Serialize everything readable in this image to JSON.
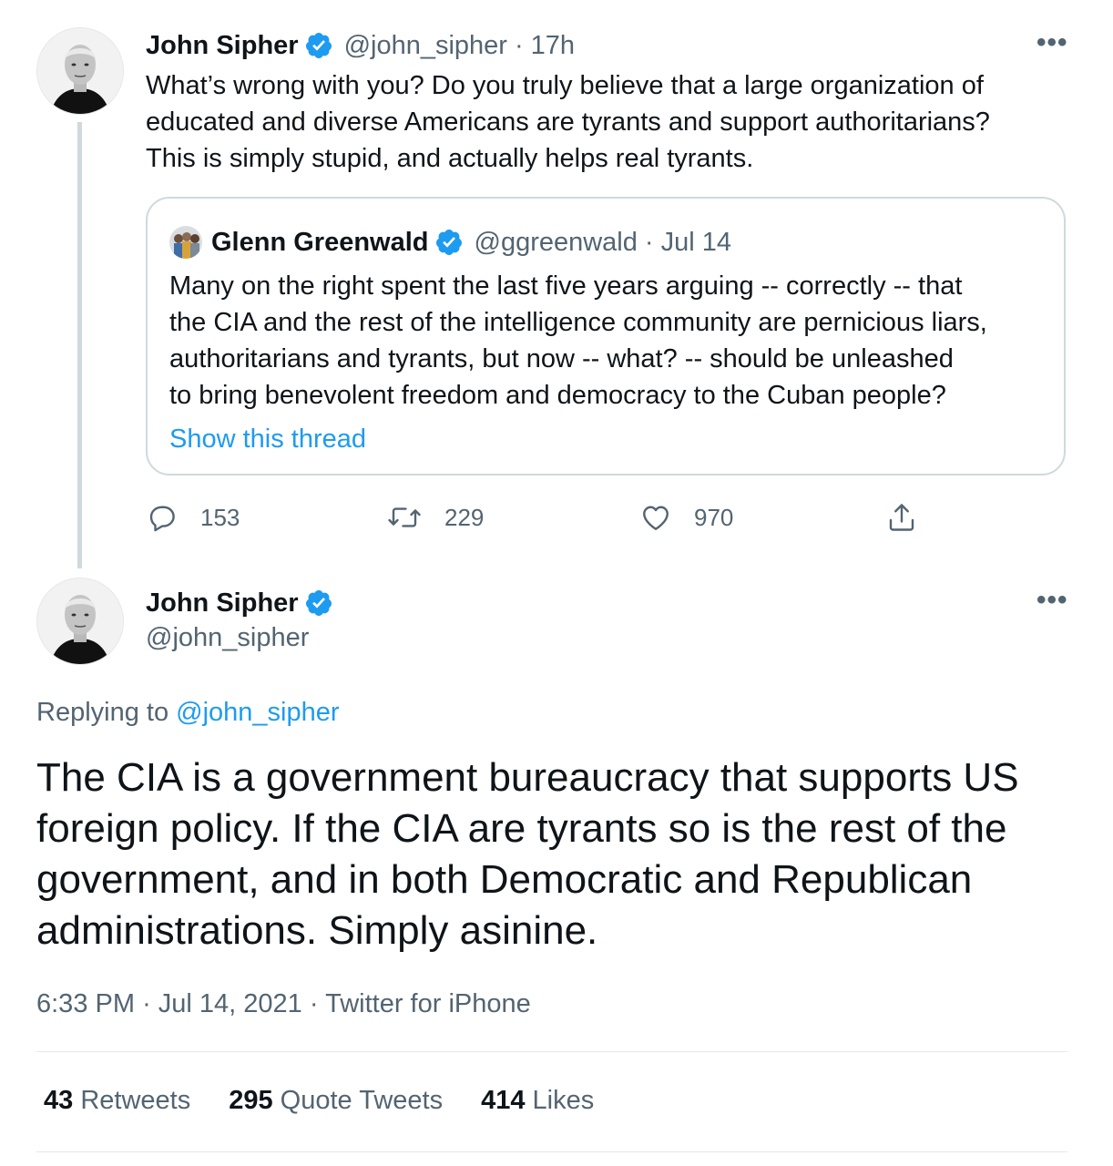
{
  "colors": {
    "accent": "#1d9bf0",
    "secondary_text": "#536471",
    "primary_text": "#0f1419",
    "border": "#cfd9de"
  },
  "parent_tweet": {
    "author_name": "John Sipher",
    "author_handle": "@john_sipher",
    "separator": "·",
    "time": "17h",
    "more_icon": "more-horizontal-icon",
    "text_lines": [
      "What’s wrong with you? Do you truly believe that a large organization of",
      "educated and diverse Americans are tyrants and support authoritarians?",
      "This is simply stupid, and actually helps real tyrants."
    ],
    "quoted": {
      "author_name": "Glenn Greenwald",
      "author_handle": "@ggreenwald",
      "separator": "·",
      "time": "Jul 14",
      "text_lines": [
        "Many on the right spent the last five years arguing -- correctly -- that",
        "the CIA and the rest of the intelligence community are pernicious liars,",
        "authoritarians and tyrants, but now -- what? -- should be unleashed",
        "to bring benevolent freedom and democracy to the Cuban people?"
      ],
      "show_thread": "Show this thread"
    },
    "actions": {
      "replies": "153",
      "retweets": "229",
      "likes": "970"
    }
  },
  "main_tweet": {
    "author_name": "John Sipher",
    "author_handle": "@john_sipher",
    "replying_prefix": "Replying to",
    "replying_handle": "@john_sipher",
    "text_lines": [
      "The CIA is a government bureaucracy that supports US",
      "foreign policy. If the CIA are tyrants so is the rest of the",
      "government, and in both Democratic and Republican",
      "administrations. Simply asinine."
    ],
    "time": "6:33 PM",
    "date": "Jul 14, 2021",
    "source": "Twitter for iPhone",
    "separator": "·",
    "stats": {
      "retweets_count": "43",
      "retweets_label": "Retweets",
      "quotes_count": "295",
      "quotes_label": "Quote Tweets",
      "likes_count": "414",
      "likes_label": "Likes"
    }
  }
}
